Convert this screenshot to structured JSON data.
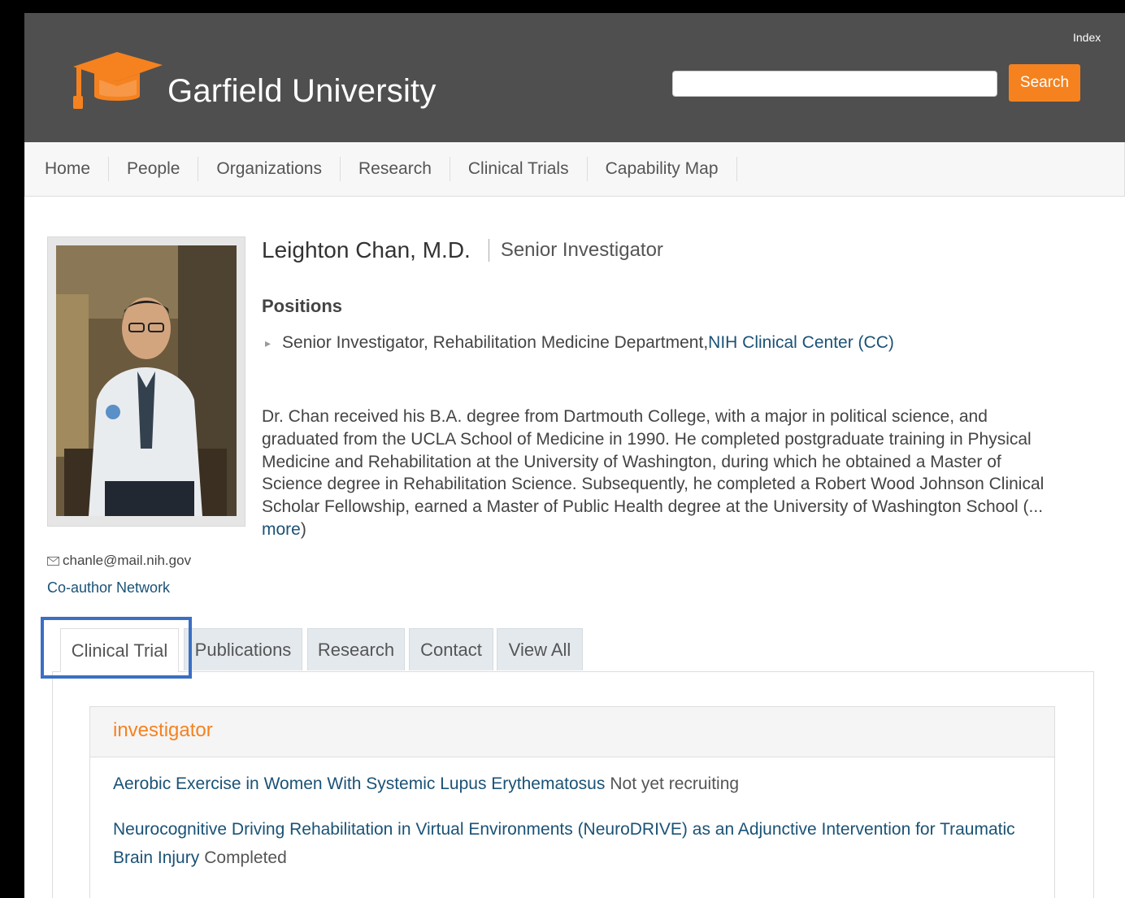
{
  "header": {
    "brand": "Garfield University",
    "index_link": "Index",
    "search": {
      "value": "",
      "placeholder": "",
      "button_label": "Search"
    },
    "colors": {
      "bar": "#4f4f4f",
      "accent": "#f5821f"
    }
  },
  "nav": {
    "items": [
      {
        "label": "Home"
      },
      {
        "label": "People"
      },
      {
        "label": "Organizations"
      },
      {
        "label": "Research"
      },
      {
        "label": "Clinical Trials"
      },
      {
        "label": "Capability Map"
      }
    ]
  },
  "profile": {
    "name": "Leighton Chan, M.D.",
    "title": "Senior Investigator",
    "positions_heading": "Positions",
    "position": {
      "text": "Senior Investigator, Rehabilitation Medicine Department, ",
      "org_link": "NIH Clinical Center (CC)"
    },
    "bio": "Dr. Chan received his B.A. degree from Dartmouth College, with a major in political science, and graduated from the UCLA School of Medicine in 1990. He completed postgraduate training in Physical Medicine and Rehabilitation at the University of Washington, during which he obtained a Master of Science degree in Rehabilitation Science. Subsequently, he completed a Robert Wood Johnson Clinical Scholar Fellowship, earned a Master of Public Health degree at the University of Washington School (",
    "bio_more_prefix": "... ",
    "bio_more_link": "more",
    "bio_more_suffix": ")",
    "email": "chanle@mail.nih.gov",
    "coauthor_link": "Co-author Network"
  },
  "tabs": [
    {
      "label": "Clinical Trial",
      "active": true
    },
    {
      "label": "Publications",
      "active": false
    },
    {
      "label": "Research",
      "active": false
    },
    {
      "label": "Contact",
      "active": false
    },
    {
      "label": "View All",
      "active": false
    }
  ],
  "clinical_trials": {
    "section_title": "investigator",
    "trials": [
      {
        "title": "Aerobic Exercise in Women With Systemic Lupus Erythematosus",
        "status": "Not yet recruiting"
      },
      {
        "title": "Neurocognitive Driving Rehabilitation in Virtual Environments (NeuroDRIVE) as an Adjunctive Intervention for Traumatic Brain Injury",
        "status": "Completed"
      }
    ]
  }
}
